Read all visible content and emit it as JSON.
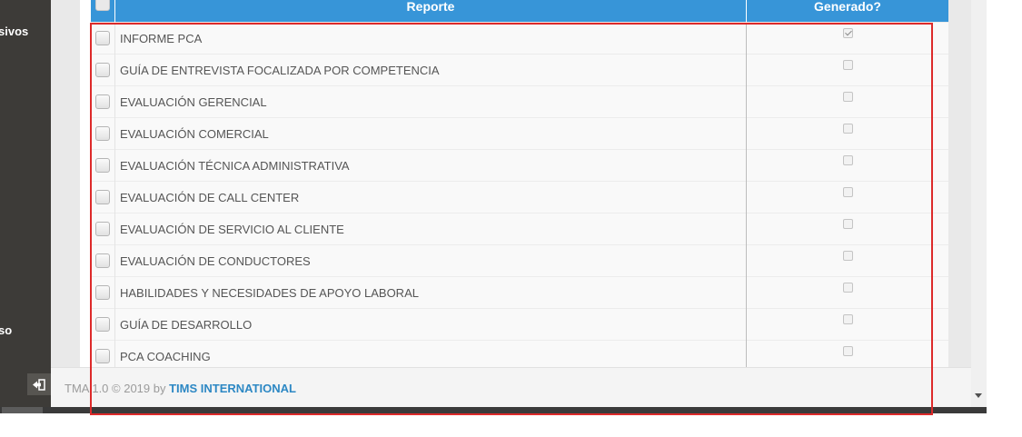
{
  "sidebar": {
    "items": [
      {
        "label": "sivos"
      },
      {
        "label": "so"
      }
    ]
  },
  "table": {
    "headers": {
      "reporte": "Reporte",
      "generado": "Generado?"
    },
    "rows": [
      {
        "name": "INFORME PCA",
        "generated": true
      },
      {
        "name": "GUÍA DE ENTREVISTA FOCALIZADA POR COMPETENCIA",
        "generated": false
      },
      {
        "name": "EVALUACIÓN GERENCIAL",
        "generated": false
      },
      {
        "name": "EVALUACIÓN COMERCIAL",
        "generated": false
      },
      {
        "name": "EVALUACIÓN TÉCNICA ADMINISTRATIVA",
        "generated": false
      },
      {
        "name": "EVALUACIÓN DE CALL CENTER",
        "generated": false
      },
      {
        "name": "EVALUACIÓN DE SERVICIO AL CLIENTE",
        "generated": false
      },
      {
        "name": "EVALUACIÓN DE CONDUCTORES",
        "generated": false
      },
      {
        "name": "HABILIDADES Y NECESIDADES DE APOYO LABORAL",
        "generated": false
      },
      {
        "name": "GUÍA DE DESARROLLO",
        "generated": false
      },
      {
        "name": "PCA COACHING",
        "generated": false
      }
    ]
  },
  "footer": {
    "prefix": "TMA 1.0 © 2019 by ",
    "brand": "TIMS INTERNATIONAL"
  },
  "colors": {
    "header_blue": "#3795d8",
    "sidebar": "#3d3b38",
    "brand_link": "#2d88c4",
    "highlight": "#dd2a2a"
  }
}
